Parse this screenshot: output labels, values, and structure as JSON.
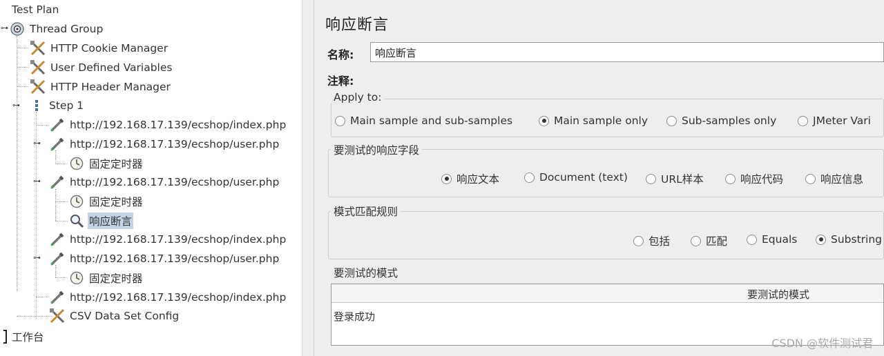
{
  "tree": {
    "root_label": "Test Plan",
    "nodes": [
      {
        "label": "Thread Group",
        "icon": "thread-group-icon"
      },
      {
        "label": "HTTP Cookie Manager",
        "icon": "config-element-icon"
      },
      {
        "label": "User Defined Variables",
        "icon": "config-element-icon"
      },
      {
        "label": "HTTP Header Manager",
        "icon": "config-element-icon"
      },
      {
        "label": "Step 1",
        "icon": "transaction-controller-icon"
      },
      {
        "label": "http://192.168.17.139/ecshop/index.php",
        "icon": "http-sampler-icon"
      },
      {
        "label": "http://192.168.17.139/ecshop/user.php",
        "icon": "http-sampler-icon"
      },
      {
        "label": "固定定时器",
        "icon": "timer-icon"
      },
      {
        "label": "http://192.168.17.139/ecshop/user.php",
        "icon": "http-sampler-icon"
      },
      {
        "label": "固定定时器",
        "icon": "timer-icon"
      },
      {
        "label": "响应断言",
        "icon": "assertion-icon"
      },
      {
        "label": "http://192.168.17.139/ecshop/index.php",
        "icon": "http-sampler-icon"
      },
      {
        "label": "http://192.168.17.139/ecshop/user.php",
        "icon": "http-sampler-icon"
      },
      {
        "label": "固定定时器",
        "icon": "timer-icon"
      },
      {
        "label": "http://192.168.17.139/ecshop/index.php",
        "icon": "http-sampler-icon"
      },
      {
        "label": "CSV Data Set Config",
        "icon": "config-element-icon"
      }
    ],
    "workbench_label": "工作台"
  },
  "panel": {
    "title": "响应断言",
    "name_label": "名称:",
    "name_value": "响应断言",
    "comment_label": "注释:",
    "apply_to": {
      "title": "Apply to:",
      "options": [
        "Main sample and sub-samples",
        "Main sample only",
        "Sub-samples only",
        "JMeter Vari"
      ],
      "selected": "Main sample only"
    },
    "field_to_test": {
      "title": "要测试的响应字段",
      "options": [
        "响应文本",
        "Document (text)",
        "URL样本",
        "响应代码",
        "响应信息"
      ],
      "selected": "响应文本"
    },
    "pattern_rules": {
      "title": "模式匹配规则",
      "options": [
        "包括",
        "匹配",
        "Equals",
        "Substring"
      ],
      "selected": "Substring"
    },
    "patterns": {
      "title": "要测试的模式",
      "column_header": "要测试的模式",
      "rows": [
        "登录成功"
      ]
    }
  },
  "watermark": "CSDN @软件测试君",
  "colors": {
    "panel_bg": "#eeeeee",
    "selection_bg": "#c6d3e6"
  }
}
